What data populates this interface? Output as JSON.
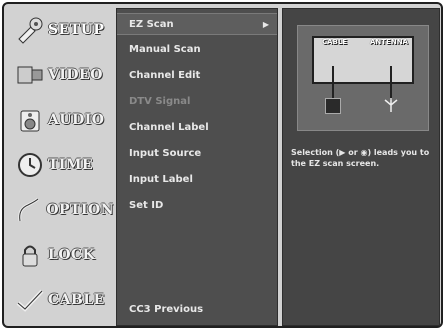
{
  "tabs": [
    {
      "label": "SETUP",
      "icon": "setup-icon"
    },
    {
      "label": "VIDEO",
      "icon": "video-icon"
    },
    {
      "label": "AUDIO",
      "icon": "audio-icon"
    },
    {
      "label": "TIME",
      "icon": "time-icon"
    },
    {
      "label": "OPTION",
      "icon": "option-icon"
    },
    {
      "label": "LOCK",
      "icon": "lock-icon"
    },
    {
      "label": "CABLE",
      "icon": "cable-icon"
    }
  ],
  "menu": {
    "items": [
      {
        "label": "EZ Scan",
        "arrow": "▶"
      },
      {
        "label": "Manual Scan"
      },
      {
        "label": "Channel Edit"
      },
      {
        "label": "DTV Signal"
      },
      {
        "label": "Channel Label"
      },
      {
        "label": "Input Source"
      },
      {
        "label": "Input Label"
      },
      {
        "label": "Set ID"
      }
    ],
    "footer": "CC3 Previous"
  },
  "info": {
    "cable_label": "CABLE",
    "antenna_label": "ANTENNA",
    "help_text": "Selection (▶ or ◉) leads you to the EZ scan screen."
  }
}
